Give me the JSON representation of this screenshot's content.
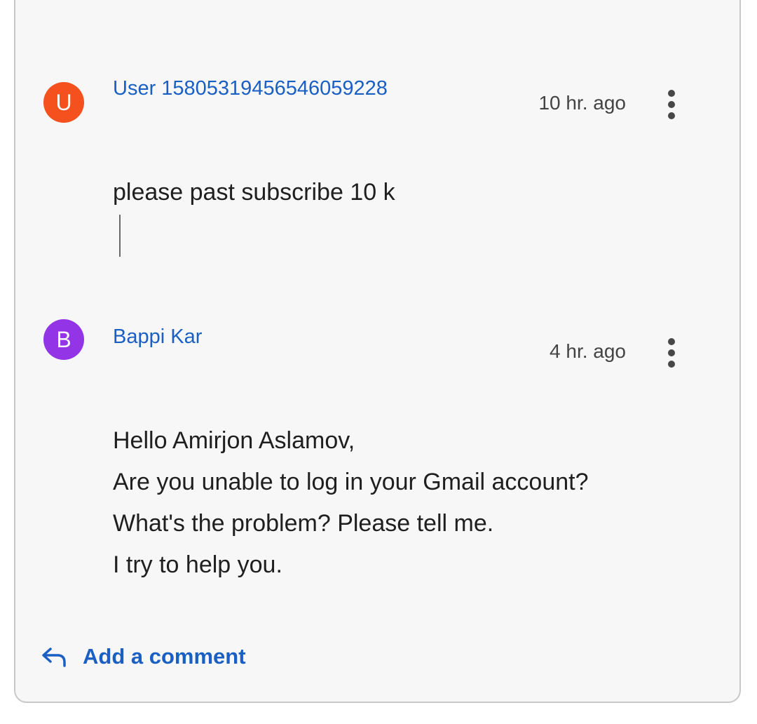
{
  "comments": [
    {
      "avatar_letter": "U",
      "avatar_color": "#f4511e",
      "author": "User 15805319456546059228",
      "time": "10 hr. ago",
      "menu_icon": "more-vert-icon",
      "lines": [
        "please past subscribe 10 k"
      ]
    },
    {
      "avatar_letter": "B",
      "avatar_color": "#9334e6",
      "author": "Bappi Kar",
      "time": "4 hr. ago",
      "menu_icon": "more-vert-icon",
      "lines": [
        "Hello Amirjon Aslamov,",
        "Are you unable to log in your Gmail account?",
        "What's the problem? Please tell me.",
        "I try to help you."
      ]
    }
  ],
  "footer": {
    "add_comment_label": "Add a comment",
    "add_comment_icon": "reply-arrow-icon"
  },
  "colors": {
    "link": "#1a5fc4",
    "card_background": "#f7f7f7",
    "card_border": "#c8c8c8"
  }
}
